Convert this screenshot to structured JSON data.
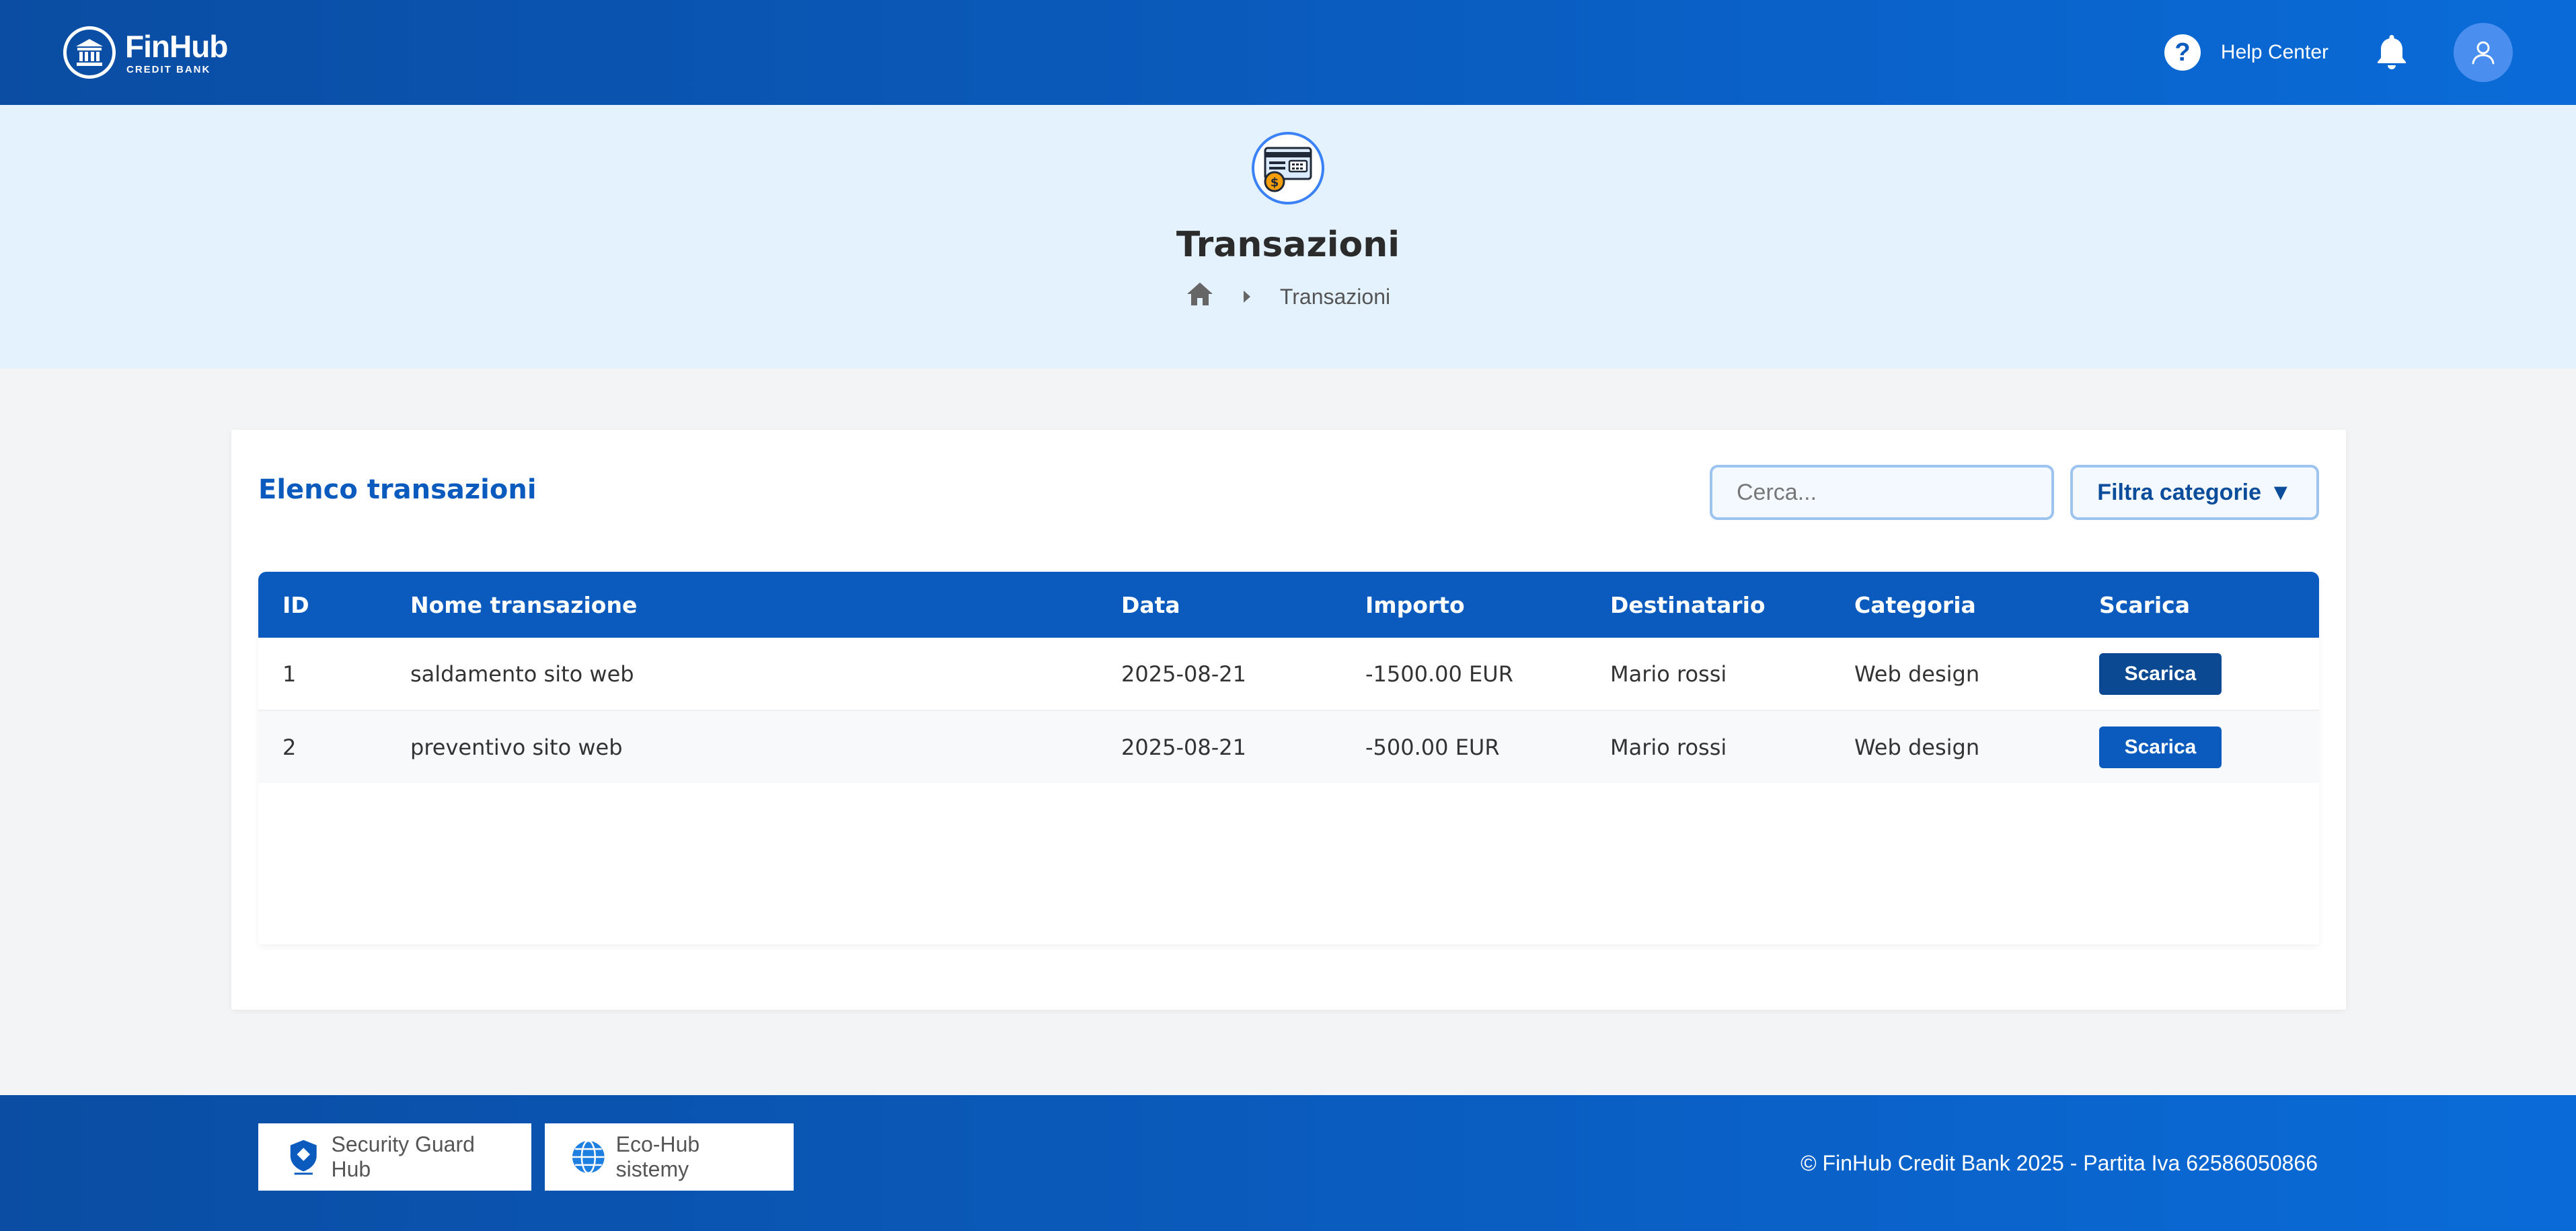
{
  "header": {
    "logo_name": "FinHub",
    "logo_sub": "CREDIT BANK",
    "help_icon_glyph": "?",
    "help_label": "Help Center",
    "icons": [
      "bank-icon",
      "help-icon",
      "bell-icon",
      "user-icon"
    ]
  },
  "hero": {
    "icon": "transactions-icon",
    "title": "Transazioni",
    "breadcrumb": [
      "home-icon",
      "Transazioni"
    ]
  },
  "card": {
    "title": "Elenco transazioni",
    "search_placeholder": "Cerca...",
    "filter_label": "Filtra categorie",
    "filter_caret": "▼"
  },
  "table": {
    "headers": [
      "ID",
      "Nome transazione",
      "Data",
      "Importo",
      "Destinatario",
      "Categoria",
      "Scarica"
    ],
    "rows": [
      [
        "1",
        "saldamento sito web",
        "2025-08-21",
        "-1500.00 EUR",
        "Mario rossi",
        "Web design",
        "Scarica"
      ],
      [
        "2",
        "preventivo sito web",
        "2025-08-21",
        "-500.00 EUR",
        "Mario rossi",
        "Web design",
        "Scarica"
      ]
    ]
  },
  "footer": {
    "partners": [
      "Security Guard Hub",
      "Eco-Hub sistemy"
    ],
    "copyright": "© FinHub Credit Bank 2025 - Partita Iva 62586050866"
  },
  "colors": {
    "primary": "#0a5bbd",
    "hero_bg": "#e4f2fe",
    "page_bg": "#f3f4f6"
  }
}
